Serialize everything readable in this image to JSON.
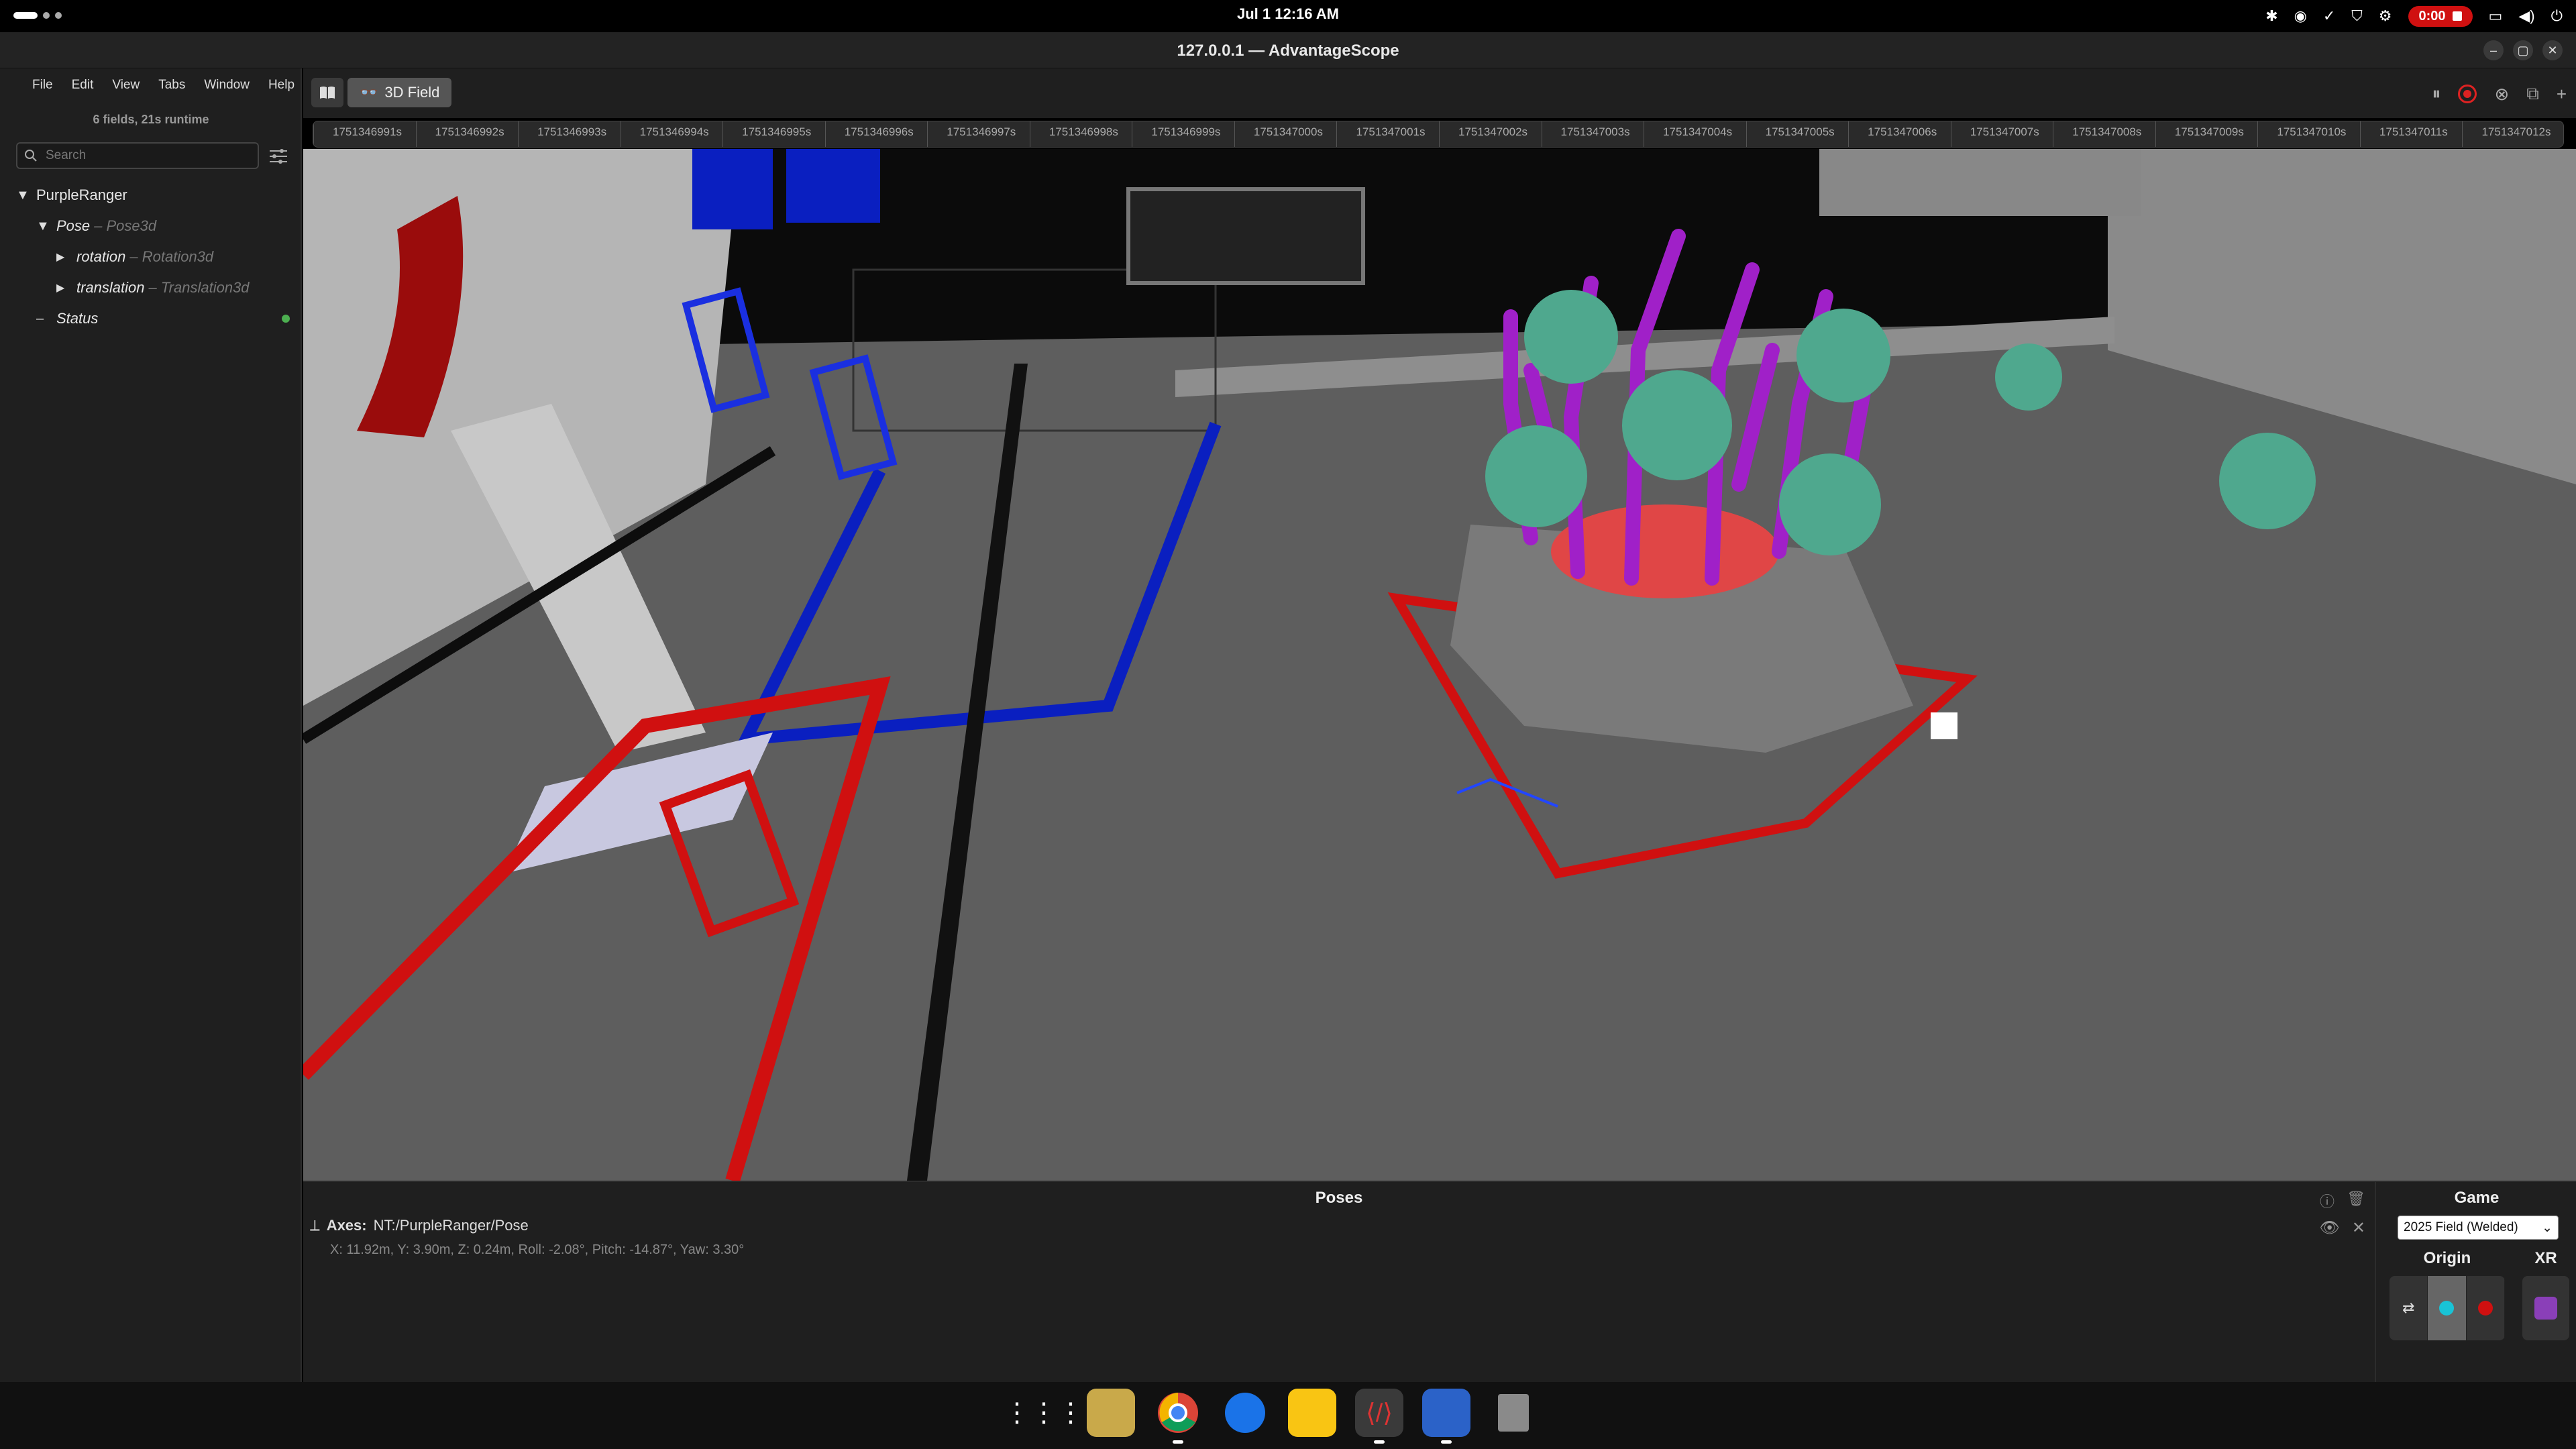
{
  "topbar": {
    "clock": "Jul 1  12:16 AM",
    "recording_time": "0:00"
  },
  "window": {
    "title": "127.0.0.1 — AdvantageScope"
  },
  "menu": [
    "File",
    "Edit",
    "View",
    "Tabs",
    "Window",
    "Help"
  ],
  "sidebar": {
    "runtime": "6 fields, 21s runtime",
    "search_placeholder": "Search",
    "tree": {
      "root": "PurpleRanger",
      "pose": {
        "name": "Pose",
        "type": "– Pose3d"
      },
      "rotation": {
        "name": "rotation",
        "type": "– Rotation3d"
      },
      "translation": {
        "name": "translation",
        "type": "– Translation3d"
      },
      "status": {
        "name": "Status"
      }
    }
  },
  "tabs": {
    "active": "3D Field"
  },
  "timeline": {
    "ticks": [
      "1751346991s",
      "1751346992s",
      "1751346993s",
      "1751346994s",
      "1751346995s",
      "1751346996s",
      "1751346997s",
      "1751346998s",
      "1751346999s",
      "1751347000s",
      "1751347001s",
      "1751347002s",
      "1751347003s",
      "1751347004s",
      "1751347005s",
      "1751347006s",
      "1751347007s",
      "1751347008s",
      "1751347009s",
      "1751347010s",
      "1751347011s",
      "1751347012s"
    ]
  },
  "poses_panel": {
    "title": "Poses",
    "axes_label": "Axes:",
    "axes_source": "NT:/PurpleRanger/Pose",
    "axes_values": "X: 11.92m, Y: 3.90m, Z: 0.24m, Roll: -2.08°, Pitch: -14.87°, Yaw: 3.30°"
  },
  "game_panel": {
    "title": "Game",
    "field": "2025 Field (Welded)",
    "origin_label": "Origin",
    "xr_label": "XR"
  },
  "colors": {
    "alliance_blue": "#0a1fc0",
    "alliance_red": "#d01010",
    "coral_purple": "#a020c8",
    "algae_green": "#4fa88e",
    "carpet": "#5e5e5e"
  },
  "icons": {
    "tab": "book-icon",
    "field_tab": "glasses-icon",
    "dock": [
      "app-grid-icon",
      "files-icon",
      "chrome-icon",
      "chat-icon",
      "notes-icon",
      "advantagescope-icon",
      "text-editor-icon",
      "trash-icon"
    ]
  }
}
